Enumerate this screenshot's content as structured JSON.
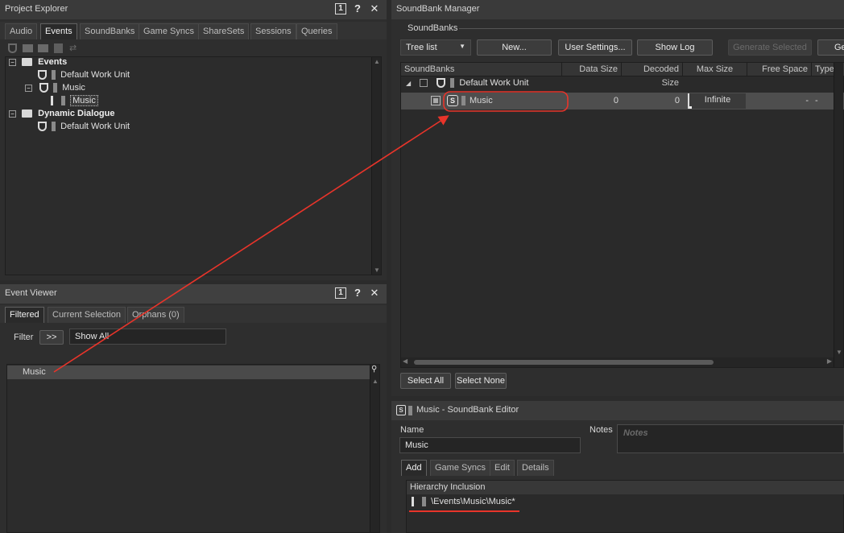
{
  "project_explorer": {
    "title": "Project Explorer",
    "tabs": [
      "Audio",
      "Events",
      "SoundBanks",
      "Game Syncs",
      "ShareSets",
      "Sessions",
      "Queries"
    ],
    "tree": {
      "events": "Events",
      "default_wu_1": "Default Work Unit",
      "music_wu": "Music",
      "music_event": "Music",
      "dynamic_dialogue": "Dynamic Dialogue",
      "default_wu_2": "Default Work Unit"
    }
  },
  "event_viewer": {
    "title": "Event Viewer",
    "tabs": [
      "Filtered",
      "Current Selection",
      "Orphans (0)"
    ],
    "filter_label": "Filter",
    "filter_button": ">>",
    "filter_value": "Show All",
    "list_item": "Music"
  },
  "soundbank_manager": {
    "title": "SoundBank Manager",
    "section_label": "SoundBanks",
    "view_select": "Tree list",
    "buttons": {
      "new": "New...",
      "user_settings": "User Settings...",
      "show_log": "Show Log",
      "generate_selected": "Generate Selected",
      "generate_all": "Ge"
    },
    "columns": [
      "SoundBanks",
      "Data Size",
      "Decoded Size",
      "Max Size",
      "Free Space",
      "Type"
    ],
    "work_unit_row": "Default Work Unit",
    "bank_row": {
      "name": "Music",
      "data_size": "0",
      "decoded_size": "0",
      "max_size": "Infinite",
      "free_space": "-",
      "type": "-"
    },
    "select_all": "Select All",
    "select_none": "Select None"
  },
  "soundbank_editor": {
    "title": "Music - SoundBank Editor",
    "name_label": "Name",
    "name_value": "Music",
    "notes_label": "Notes",
    "notes_placeholder": "Notes",
    "tabs": [
      "Add",
      "Game Syncs",
      "Edit",
      "Details"
    ],
    "hierarchy_header": "Hierarchy Inclusion",
    "hierarchy_item": "\\Events\\Music\\Music*"
  },
  "annotation": {
    "arrow_color": "#e8342a",
    "highlight_color": "#e8342a"
  }
}
